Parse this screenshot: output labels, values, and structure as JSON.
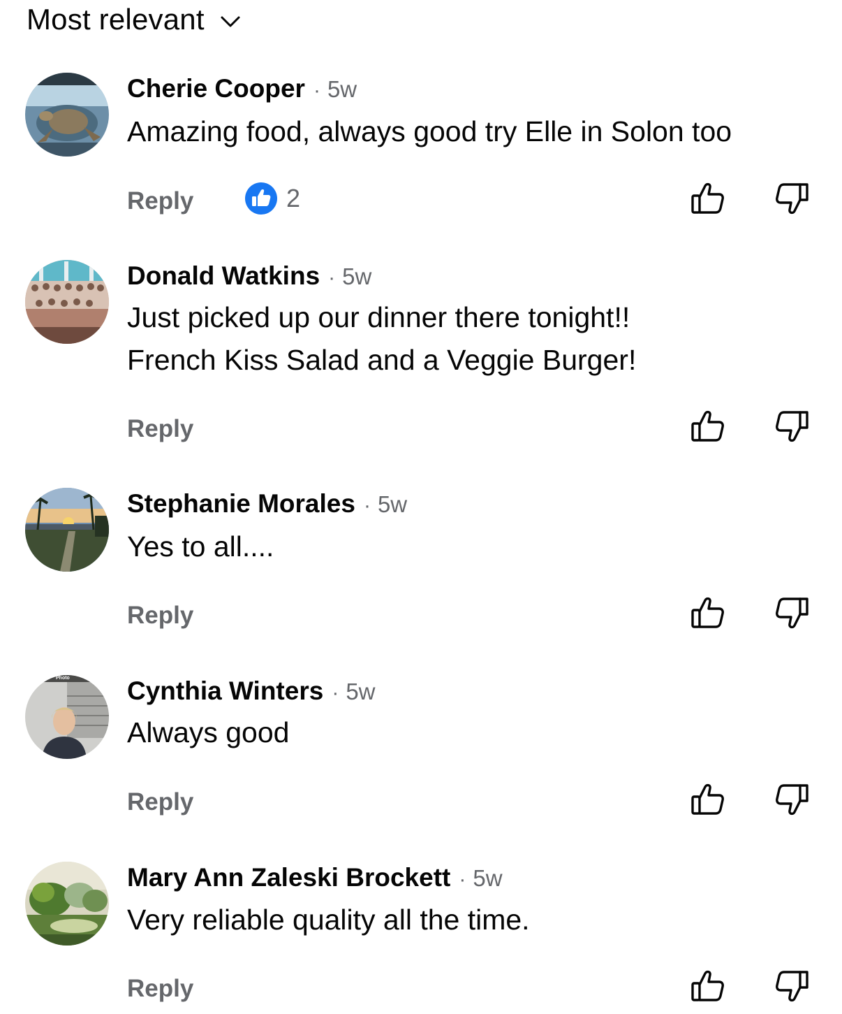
{
  "sort": {
    "label": "Most relevant"
  },
  "icons": {
    "sort_chevron": "chevron-down-icon",
    "like": "thumbs-up-outline-icon",
    "dislike": "thumbs-down-outline-icon",
    "reaction": "like-reaction-badge-icon"
  },
  "colors": {
    "text": "#050505",
    "secondary": "#65676b",
    "like_blue": "#1877f2"
  },
  "separator": "·",
  "reply_label": "Reply",
  "comments": [
    {
      "author": "Cherie Cooper",
      "age": "5w",
      "lines": [
        "Amazing food, always good try Elle in Solon too"
      ],
      "reaction_count": "2"
    },
    {
      "author": "Donald Watkins",
      "age": "5w",
      "lines": [
        "Just picked up our dinner there tonight!!",
        "French Kiss Salad and a Veggie Burger!"
      ]
    },
    {
      "author": "Stephanie Morales",
      "age": "5w",
      "lines": [
        "Yes to all...."
      ]
    },
    {
      "author": "Cynthia Winters",
      "age": "5w",
      "lines": [
        "Always good"
      ],
      "avatar_caption": "Photo"
    },
    {
      "author": "Mary Ann Zaleski Brockett",
      "age": "5w",
      "lines": [
        "Very reliable quality all the time."
      ]
    }
  ]
}
